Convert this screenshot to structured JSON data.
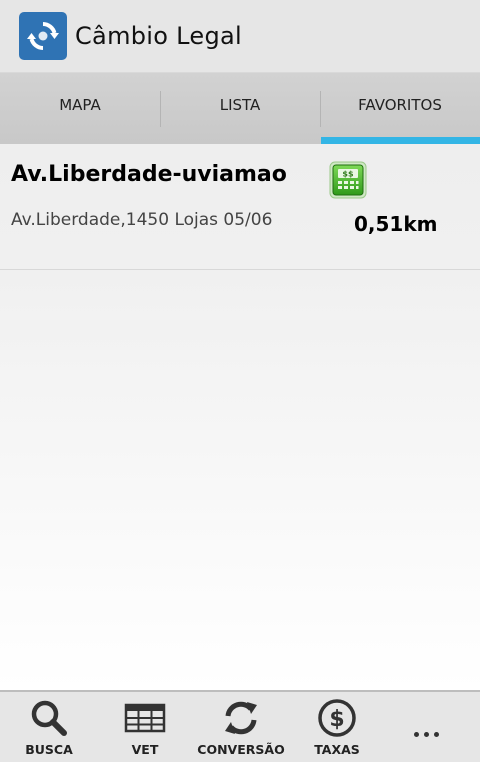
{
  "app": {
    "title": "Câmbio Legal",
    "icon": "exchange-arrows-icon",
    "icon_color": "#2f73b4"
  },
  "tabs": [
    {
      "label": "MAPA",
      "active": false
    },
    {
      "label": "LISTA",
      "active": false
    },
    {
      "label": "FAVORITOS",
      "active": true
    }
  ],
  "accent_color": "#33b5e5",
  "favorites": [
    {
      "name": "Av.Liberdade-uviamao",
      "address": "Av.Liberdade,1450 Lojas 05/06",
      "distance": "0,51km",
      "icon": "money-exchange-icon"
    }
  ],
  "bottom_bar": {
    "items": [
      {
        "label": "BUSCA",
        "icon": "search-icon"
      },
      {
        "label": "VET",
        "icon": "table-icon"
      },
      {
        "label": "CONVERSÃO",
        "icon": "refresh-icon"
      },
      {
        "label": "TAXAS",
        "icon": "dollar-circle-icon"
      }
    ],
    "overflow_icon": "more-options-icon"
  }
}
